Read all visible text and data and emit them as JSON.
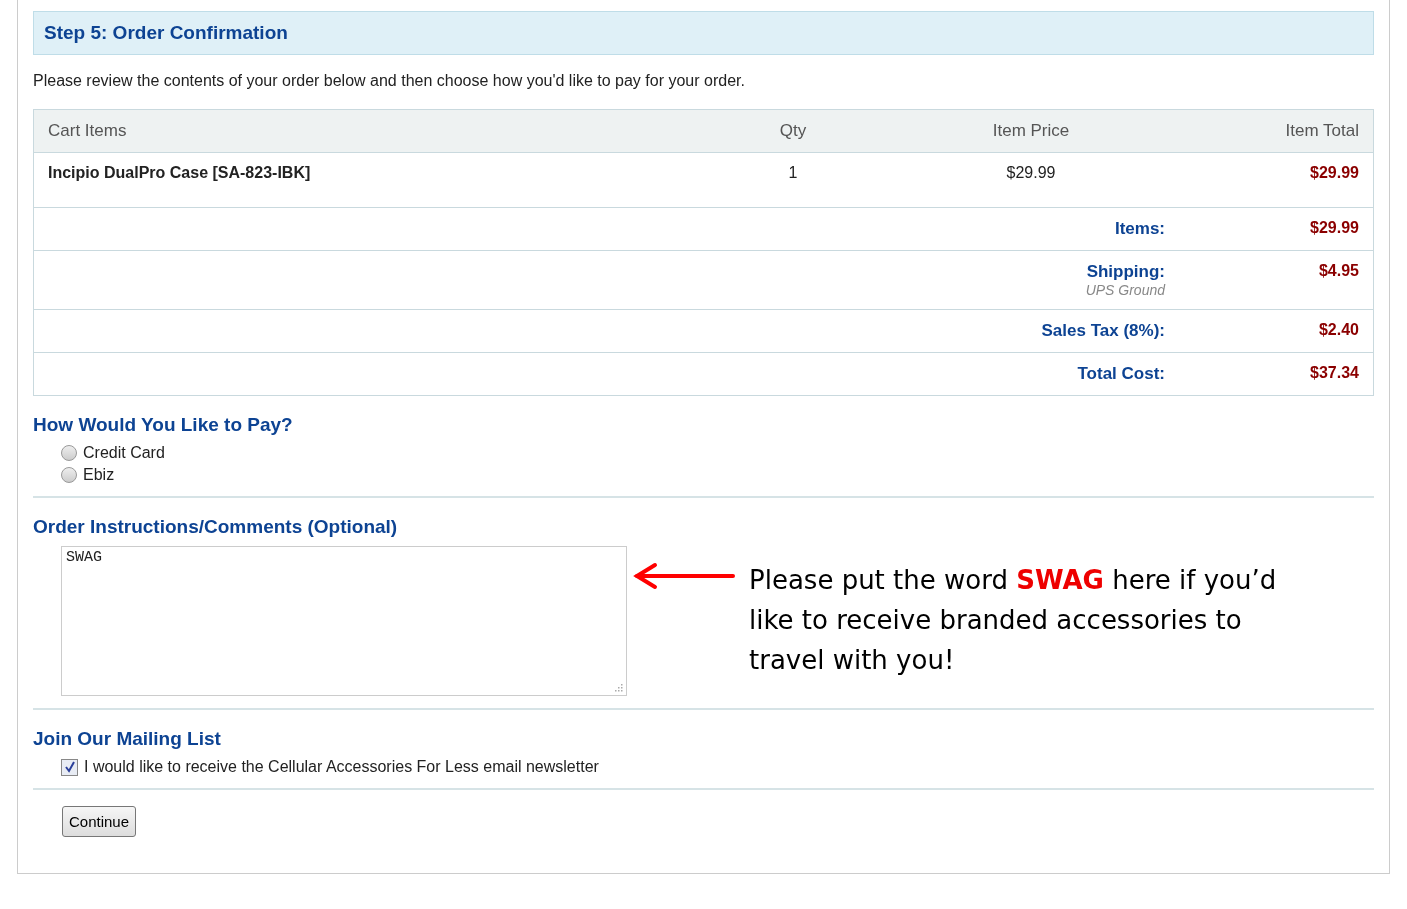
{
  "step_title": "Step 5: Order Confirmation",
  "intro": "Please review the contents of your order below and then choose how you'd like to pay for your order.",
  "cart": {
    "columns": [
      "Cart Items",
      "Qty",
      "Item Price",
      "Item Total"
    ],
    "rows": [
      {
        "item": "Incipio DualPro Case [SA-823-IBK]",
        "qty": "1",
        "price": "$29.99",
        "total": "$29.99"
      }
    ],
    "summary": [
      {
        "label": "Items:",
        "value": "$29.99"
      },
      {
        "label": "Shipping:",
        "note": "UPS Ground",
        "value": "$4.95"
      },
      {
        "label": "Sales Tax (8%):",
        "value": "$2.40"
      },
      {
        "label": "Total Cost:",
        "value": "$37.34"
      }
    ]
  },
  "payment": {
    "heading": "How Would You Like to Pay?",
    "options": [
      {
        "label": "Credit Card",
        "selected": false
      },
      {
        "label": "Ebiz",
        "selected": false
      }
    ]
  },
  "comments": {
    "heading": "Order Instructions/Comments (Optional)",
    "value": "SWAG"
  },
  "annotation": "Please put the word **SWAG** here if you’d like to receive branded accessories to travel with you!",
  "mailing": {
    "heading": "Join Our Mailing List",
    "label": "I would like to receive the Cellular Accessories For Less email newsletter",
    "checked": true
  },
  "continue_button": "Continue"
}
